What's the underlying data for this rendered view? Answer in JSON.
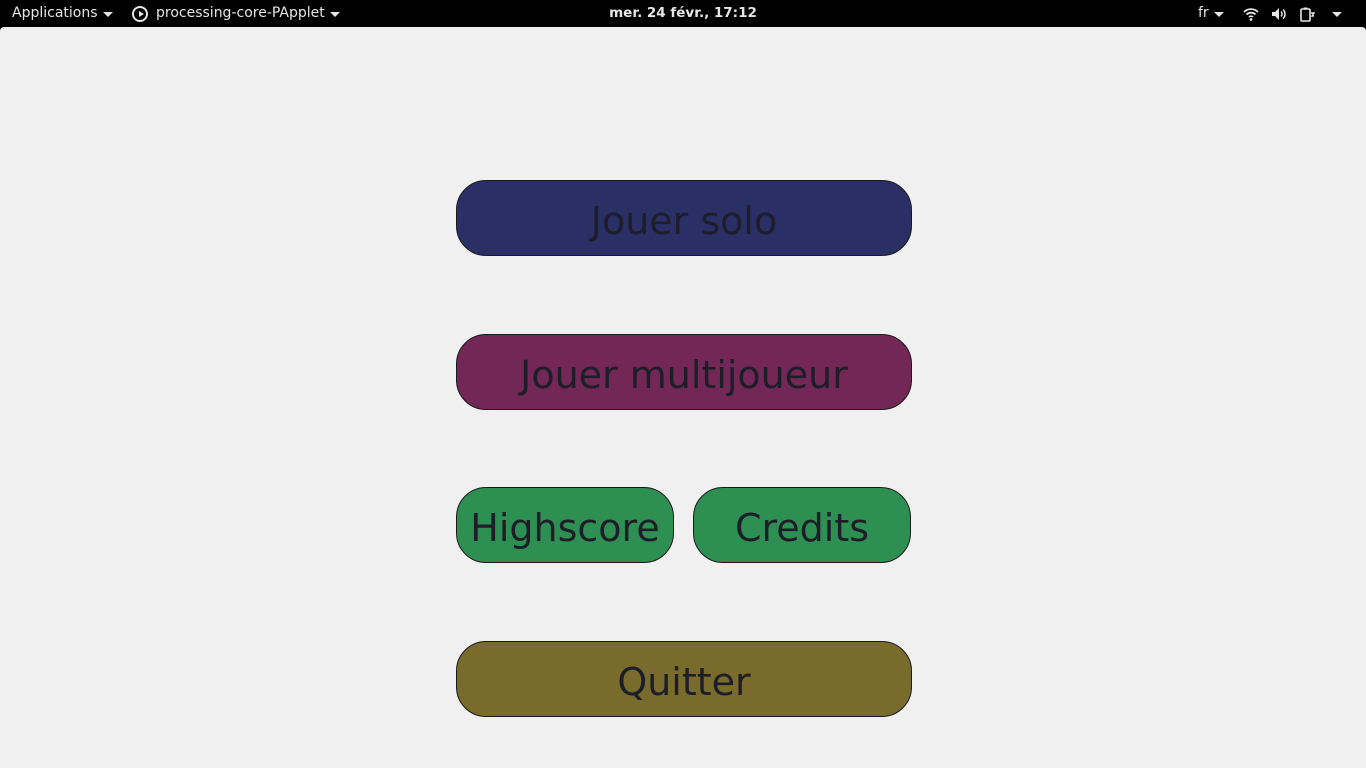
{
  "topbar": {
    "applications_label": "Applications",
    "app_name": "processing-core-PApplet",
    "clock": "mer. 24 févr., 17:12",
    "language": "fr",
    "tray_icons": [
      "wifi-icon",
      "volume-icon",
      "battery-icon"
    ]
  },
  "menu": {
    "solo_label": "Jouer solo",
    "multi_label": "Jouer multijoueur",
    "highscore_label": "Highscore",
    "credits_label": "Credits",
    "quit_label": "Quitter"
  },
  "colors": {
    "background": "#f0f0f0",
    "solo": "#2a2f66",
    "multi": "#722756",
    "highscore": "#2e8f52",
    "credits": "#2e8f52",
    "quit": "#796b2c"
  }
}
